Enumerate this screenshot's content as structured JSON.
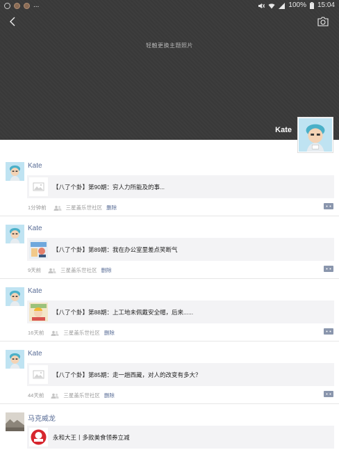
{
  "status": {
    "ellipsis": "...",
    "battery": "100%",
    "time": "15:04"
  },
  "cover": {
    "hint": "轻触更换主题照片",
    "profile_name": "Kate"
  },
  "posts": [
    {
      "author": "Kate",
      "title": "【八了个卦】第90期：穷人力所能及的事...",
      "time": "1分钟前",
      "community": "三星盖乐世社区",
      "delete": "删除",
      "thumb": "image-placeholder"
    },
    {
      "author": "Kate",
      "title": "【八了个卦】第89期：我在办公室里差点笑断气",
      "time": "9天前",
      "community": "三星盖乐世社区",
      "delete": "删除",
      "thumb": "office-cartoon"
    },
    {
      "author": "Kate",
      "title": "【八了个卦】第88期：上工地未佩戴安全帽，后来......",
      "time": "16天前",
      "community": "三星盖乐世社区",
      "delete": "删除",
      "thumb": "worksite-cartoon"
    },
    {
      "author": "Kate",
      "title": "【八了个卦】第85期：走一趟西藏，对人的改变有多大？",
      "time": "44天前",
      "community": "三星盖乐世社区",
      "delete": "删除",
      "thumb": "image-placeholder"
    },
    {
      "author": "马克威龙",
      "title": "永和大王丨多款美食领券立减",
      "thumb": "brand-logo"
    }
  ],
  "colors": {
    "link": "#576b95",
    "cover_bg": "#3a3a3a"
  }
}
